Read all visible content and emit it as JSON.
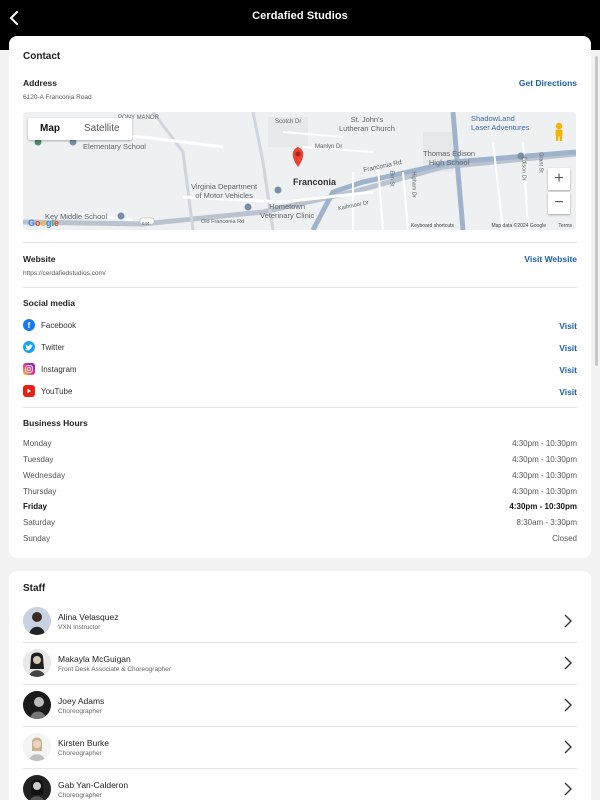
{
  "header": {
    "title": "Cerdafied Studios"
  },
  "contact": {
    "title": "Contact",
    "address_label": "Address",
    "address": "6120-A Franconia Road",
    "directions_label": "Get Directions",
    "map": {
      "tab_map": "Map",
      "tab_satellite": "Satellite",
      "zoom_in": "+",
      "zoom_out": "−",
      "labels": {
        "st_johns": "St. John's\nLutheran Church",
        "shadowland": "ShadowLand\nLaser Adventures",
        "elementary": "Elementary School",
        "scotch": "Scotch Dr",
        "manlyn": "Manlyn Dr",
        "franconia_rd": "Franconia Rd",
        "edison": "Thomas Edison\nHigh School",
        "franconia": "Franconia",
        "va_dmv": "Virginia Department\nof Motor Vehicles",
        "hometown": "Hometown\nVeterinary Clinic",
        "key_middle": "Key Middle School",
        "kathmoor": "Kathmoor Dr",
        "old_franconia": "Old Franconia Rd",
        "elm_st": "Elm St",
        "higham": "Higham Dr",
        "edison_dr": "Edison Dr",
        "grant_st": "Grant St",
        "route_644": "644",
        "pony": "PONY MANOR"
      },
      "google": "Google",
      "shortcuts": "Keyboard shortcuts",
      "mapdata": "Map data ©2024 Google",
      "terms": "Terms"
    },
    "website_label": "Website",
    "website_url": "https://cerdafiedstudios.com/",
    "website_link": "Visit Website",
    "social_label": "Social media",
    "social": [
      {
        "name": "Facebook",
        "action": "Visit",
        "color": "#1877f2",
        "icon": "facebook-icon"
      },
      {
        "name": "Twitter",
        "action": "Visit",
        "color": "#1da1f2",
        "icon": "twitter-icon"
      },
      {
        "name": "Instagram",
        "action": "Visit",
        "color": "#d6249f",
        "icon": "instagram-icon"
      },
      {
        "name": "YouTube",
        "action": "Visit",
        "color": "#e62117",
        "icon": "youtube-icon"
      }
    ],
    "hours_label": "Business Hours",
    "hours": [
      {
        "day": "Monday",
        "time": "4:30pm - 10:30pm"
      },
      {
        "day": "Tuesday",
        "time": "4:30pm - 10:30pm"
      },
      {
        "day": "Wednesday",
        "time": "4:30pm - 10:30pm"
      },
      {
        "day": "Thursday",
        "time": "4:30pm - 10:30pm"
      },
      {
        "day": "Friday",
        "time": "4:30pm - 10:30pm",
        "current": true
      },
      {
        "day": "Saturday",
        "time": "8:30am - 3:30pm"
      },
      {
        "day": "Sunday",
        "time": "Closed"
      }
    ]
  },
  "staff": {
    "title": "Staff",
    "members": [
      {
        "name": "Alina Velasquez",
        "role": "VXN Instructor"
      },
      {
        "name": "Makayla McGuigan",
        "role": "Front Desk Associate & Choreographer"
      },
      {
        "name": "Joey Adams",
        "role": "Choreographer"
      },
      {
        "name": "Kirsten Burke",
        "role": "Choreographer"
      },
      {
        "name": "Gab Yan-Calderon",
        "role": "Choreographer"
      }
    ]
  },
  "colors": {
    "accent": "#1a5fa8",
    "topbar": "#000000",
    "map_pin": "#ea4335"
  }
}
